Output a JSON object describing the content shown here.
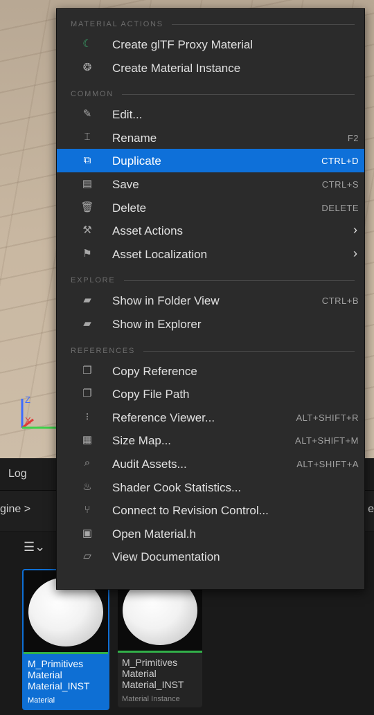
{
  "viewport": {
    "axis": {
      "z_label": "Z",
      "x_label": "X",
      "z_color": "#3c6bff",
      "x_color": "#e03a3a",
      "y_color": "#3fd14b"
    }
  },
  "panel": {
    "tab_log": "Log",
    "breadcrumb": "gine >",
    "breadcrumb_right": "e",
    "filter_icon": "filter-icon"
  },
  "assets": [
    {
      "name_line1": "M_Primitives",
      "name_line2": "Material",
      "name_line3": "Material_INST",
      "type": "Material",
      "selected": true
    },
    {
      "name_line1": "M_Primitives",
      "name_line2": "Material",
      "name_line3": "Material_INST",
      "type": "Material Instance",
      "selected": false
    }
  ],
  "menu": {
    "highlight_color": "#0e70d9",
    "sections": [
      {
        "label": "MATERIAL ACTIONS",
        "items": [
          {
            "label": "Create glTF Proxy Material",
            "shortcut": "",
            "icon": "gltf-icon"
          },
          {
            "label": "Create Material Instance",
            "shortcut": "",
            "icon": "material-instance-icon"
          }
        ]
      },
      {
        "label": "COMMON",
        "items": [
          {
            "label": "Edit...",
            "shortcut": "",
            "icon": "edit-icon"
          },
          {
            "label": "Rename",
            "shortcut": "F2",
            "icon": "rename-icon"
          },
          {
            "label": "Duplicate",
            "shortcut": "CTRL+D",
            "icon": "duplicate-icon",
            "highlighted": true
          },
          {
            "label": "Save",
            "shortcut": "CTRL+S",
            "icon": "save-icon"
          },
          {
            "label": "Delete",
            "shortcut": "DELETE",
            "icon": "delete-icon"
          },
          {
            "label": "Asset Actions",
            "shortcut": "",
            "icon": "wrench-icon",
            "submenu": true
          },
          {
            "label": "Asset Localization",
            "shortcut": "",
            "icon": "flag-icon",
            "submenu": true
          }
        ]
      },
      {
        "label": "EXPLORE",
        "items": [
          {
            "label": "Show in Folder View",
            "shortcut": "CTRL+B",
            "icon": "folder-search-icon"
          },
          {
            "label": "Show in Explorer",
            "shortcut": "",
            "icon": "folder-search-icon"
          }
        ]
      },
      {
        "label": "REFERENCES",
        "items": [
          {
            "label": "Copy Reference",
            "shortcut": "",
            "icon": "copy-icon"
          },
          {
            "label": "Copy File Path",
            "shortcut": "",
            "icon": "copy-icon"
          },
          {
            "label": "Reference Viewer...",
            "shortcut": "ALT+SHIFT+R",
            "icon": "reference-viewer-icon"
          },
          {
            "label": "Size Map...",
            "shortcut": "ALT+SHIFT+M",
            "icon": "size-map-icon"
          },
          {
            "label": "Audit Assets...",
            "shortcut": "ALT+SHIFT+A",
            "icon": "audit-icon"
          },
          {
            "label": "Shader Cook Statistics...",
            "shortcut": "",
            "icon": "shader-icon"
          },
          {
            "label": "Connect to Revision Control...",
            "shortcut": "",
            "icon": "revision-control-icon"
          },
          {
            "label": "Open Material.h",
            "shortcut": "",
            "icon": "cpp-file-icon"
          },
          {
            "label": "View Documentation",
            "shortcut": "",
            "icon": "documentation-icon"
          }
        ]
      }
    ]
  }
}
